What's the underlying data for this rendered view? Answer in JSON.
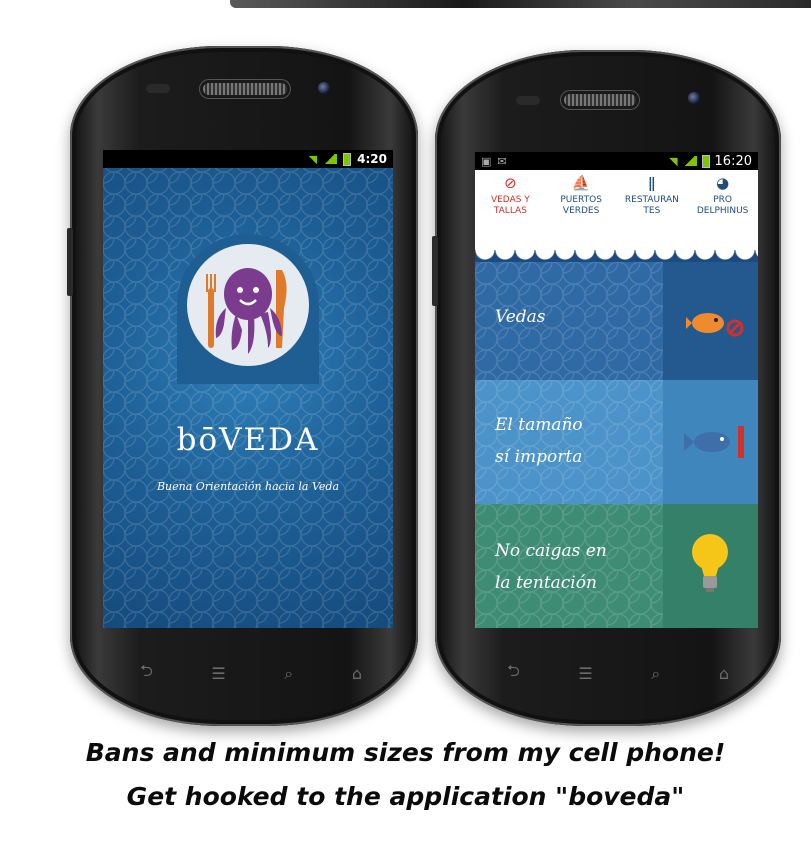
{
  "left_screen": {
    "status_time": "4:20",
    "app_title": "bōVEDA",
    "app_subtitle": "Buena Orientación hacia la Veda"
  },
  "right_screen": {
    "status_time": "16:20",
    "tabs": [
      {
        "label": "VEDAS Y TALLAS",
        "icon": "ban-icon"
      },
      {
        "label": "PUERTOS VERDES",
        "icon": "sailboat-icon"
      },
      {
        "label": "RESTAURANTES",
        "icon": "cutlery-icon"
      },
      {
        "label": "PRO DELPHINUS",
        "icon": "globe-icon"
      }
    ],
    "sections": [
      {
        "title": "Vedas",
        "icon": "fish-ban-icon",
        "color": "#2f6aa5"
      },
      {
        "title_line1": "El tamaño",
        "title_line2": "sí importa",
        "icon": "fish-ruler-icon",
        "color": "#4b93c9"
      },
      {
        "title_line1": "No caigas en",
        "title_line2": "la tentación",
        "icon": "lightbulb-icon",
        "color": "#3f8c74"
      }
    ]
  },
  "caption": {
    "line1": "Bans and minimum sizes from my cell phone!",
    "line2": "Get hooked to the application \"boveda\""
  }
}
